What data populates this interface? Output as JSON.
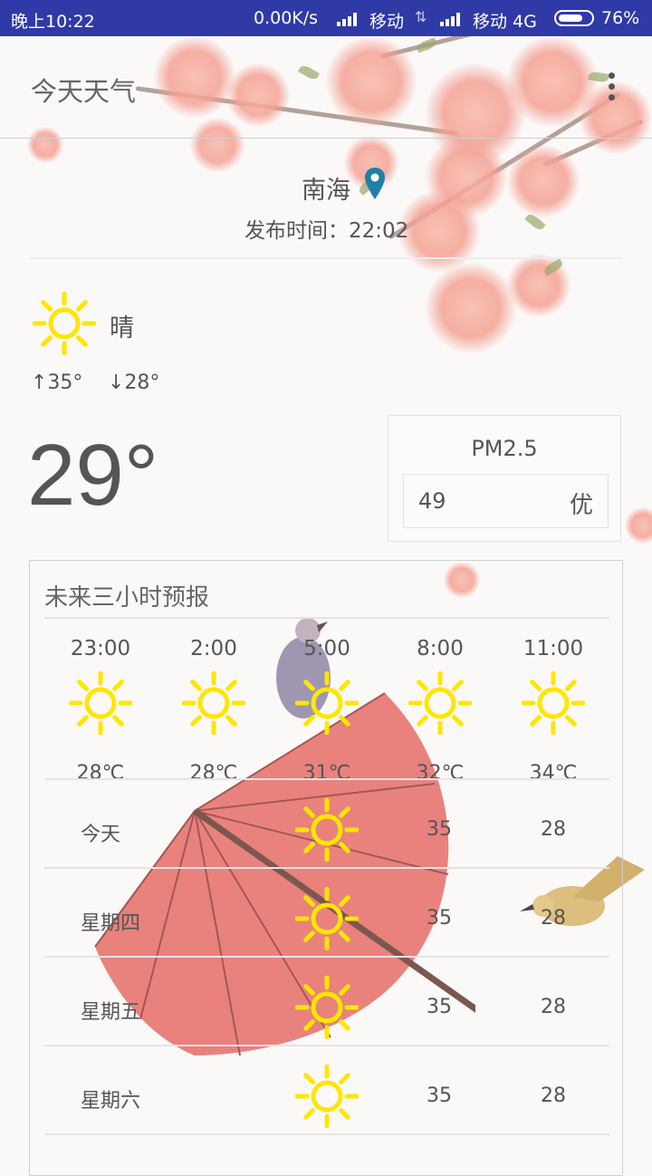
{
  "status_bar": {
    "time": "晚上10:22",
    "speed": "0.00K/s",
    "carrier1": "移动",
    "carrier2": "移动 4G",
    "battery": "76%",
    "battery_level": 0.76
  },
  "app": {
    "title": "今天天气"
  },
  "location": {
    "city": "南海",
    "publish_time": "发布时间：22:02"
  },
  "current": {
    "icon": "sun-icon",
    "condition": "晴",
    "high": "↑35°",
    "low": "↓28°",
    "temperature": "29°"
  },
  "pm25": {
    "title": "PM2.5",
    "value": "49",
    "level": "优"
  },
  "forecast": {
    "title": "未来三小时预报",
    "hourly": [
      {
        "time": "23:00",
        "icon": "sun-icon",
        "temp": "28℃"
      },
      {
        "time": "2:00",
        "icon": "sun-icon",
        "temp": "28℃"
      },
      {
        "time": "5:00",
        "icon": "sun-icon",
        "temp": "31℃"
      },
      {
        "time": "8:00",
        "icon": "sun-icon",
        "temp": "32℃"
      },
      {
        "time": "11:00",
        "icon": "sun-icon",
        "temp": "34℃"
      }
    ],
    "daily": [
      {
        "day": "今天",
        "icon": "sun-icon",
        "high": "35",
        "low": "28"
      },
      {
        "day": "星期四",
        "icon": "sun-icon",
        "high": "35",
        "low": "28"
      },
      {
        "day": "星期五",
        "icon": "sun-icon",
        "high": "35",
        "low": "28"
      },
      {
        "day": "星期六",
        "icon": "sun-icon",
        "high": "35",
        "low": "28"
      }
    ]
  },
  "colors": {
    "status_bar": "#2f3aa6",
    "sun": "#ffe600",
    "text": "#555555"
  }
}
